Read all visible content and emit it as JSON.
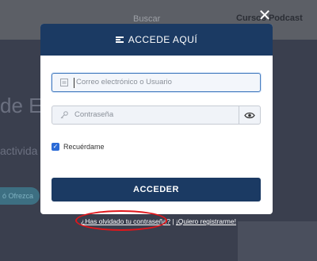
{
  "background": {
    "search_text": "Buscar",
    "nav_text": "Cursos   Podcast",
    "headline": "de Es",
    "subline": "activida",
    "pill": "ó Ofrezca"
  },
  "modal": {
    "title": "ACCEDE AQUÍ",
    "email_placeholder": "Correo electrónico o Usuario",
    "password_placeholder": "Contraseña",
    "remember_label": "Recuérdame",
    "remember_checked": true,
    "submit_label": "ACCEDER"
  },
  "footer_links": {
    "forgot": "¿Has olvidado tu contraseña?",
    "separator": " | ",
    "register": "¡Quiero registrarme!"
  },
  "annotation": {
    "color": "#e0161b"
  },
  "colors": {
    "brand": "#1b3a63",
    "checkbox": "#2a6ad6"
  },
  "icons": [
    "close-icon",
    "login-icon",
    "user-icon",
    "key-icon",
    "eye-icon",
    "check-icon"
  ]
}
